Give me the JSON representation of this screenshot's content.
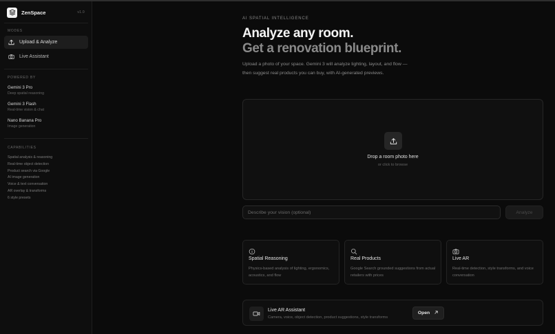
{
  "app": {
    "name": "ZenSpace",
    "version": "v1.0"
  },
  "sidebar": {
    "modes_label": "MODES",
    "modes": [
      {
        "label": "Upload & Analyze",
        "icon": "upload-icon",
        "active": true
      },
      {
        "label": "Live Assistant",
        "icon": "camera-icon",
        "active": false
      }
    ],
    "powered_label": "POWERED BY",
    "models": [
      {
        "name": "Gemini 3 Pro",
        "desc": "Deep spatial reasoning"
      },
      {
        "name": "Gemini 3 Flash",
        "desc": "Real-time vision & chat"
      },
      {
        "name": "Nano Banana Pro",
        "desc": "Image generation"
      }
    ],
    "capabilities_label": "CAPABILITIES",
    "capabilities": [
      "Spatial analysis & reasoning",
      "Real-time object detection",
      "Product search via Google",
      "AI image generation",
      "Voice & text conversation",
      "AR overlay & transforms",
      "6 style presets"
    ]
  },
  "hero": {
    "eyebrow": "AI SPATIAL INTELLIGENCE",
    "title": "Analyze any room.",
    "subtitle": "Get a renovation blueprint.",
    "description": "Upload a photo of your space. Gemini 3 will analyze lighting, layout, and flow — then suggest real products you can buy, with AI-generated previews."
  },
  "dropzone": {
    "title": "Drop a room photo here",
    "subtitle": "or click to browse",
    "icon": "upload-icon"
  },
  "vision_input": {
    "placeholder": "Describe your vision (optional)",
    "value": ""
  },
  "analyze_button": {
    "label": "Analyze"
  },
  "features": [
    {
      "icon": "info-icon",
      "title": "Spatial Reasoning",
      "desc": "Physics-based analysis of lighting, ergonomics, acoustics, and flow"
    },
    {
      "icon": "search-icon",
      "title": "Real Products",
      "desc": "Google Search grounded suggestions from actual retailers with prices"
    },
    {
      "icon": "camera-icon",
      "title": "Live AR",
      "desc": "Real-time detection, style transforms, and voice conversation"
    }
  ],
  "live_ar": {
    "icon": "video-icon",
    "title": "Live AR Assistant",
    "subtitle": "Camera, voice, object detection, product suggestions, style transforms",
    "button": "Open"
  }
}
